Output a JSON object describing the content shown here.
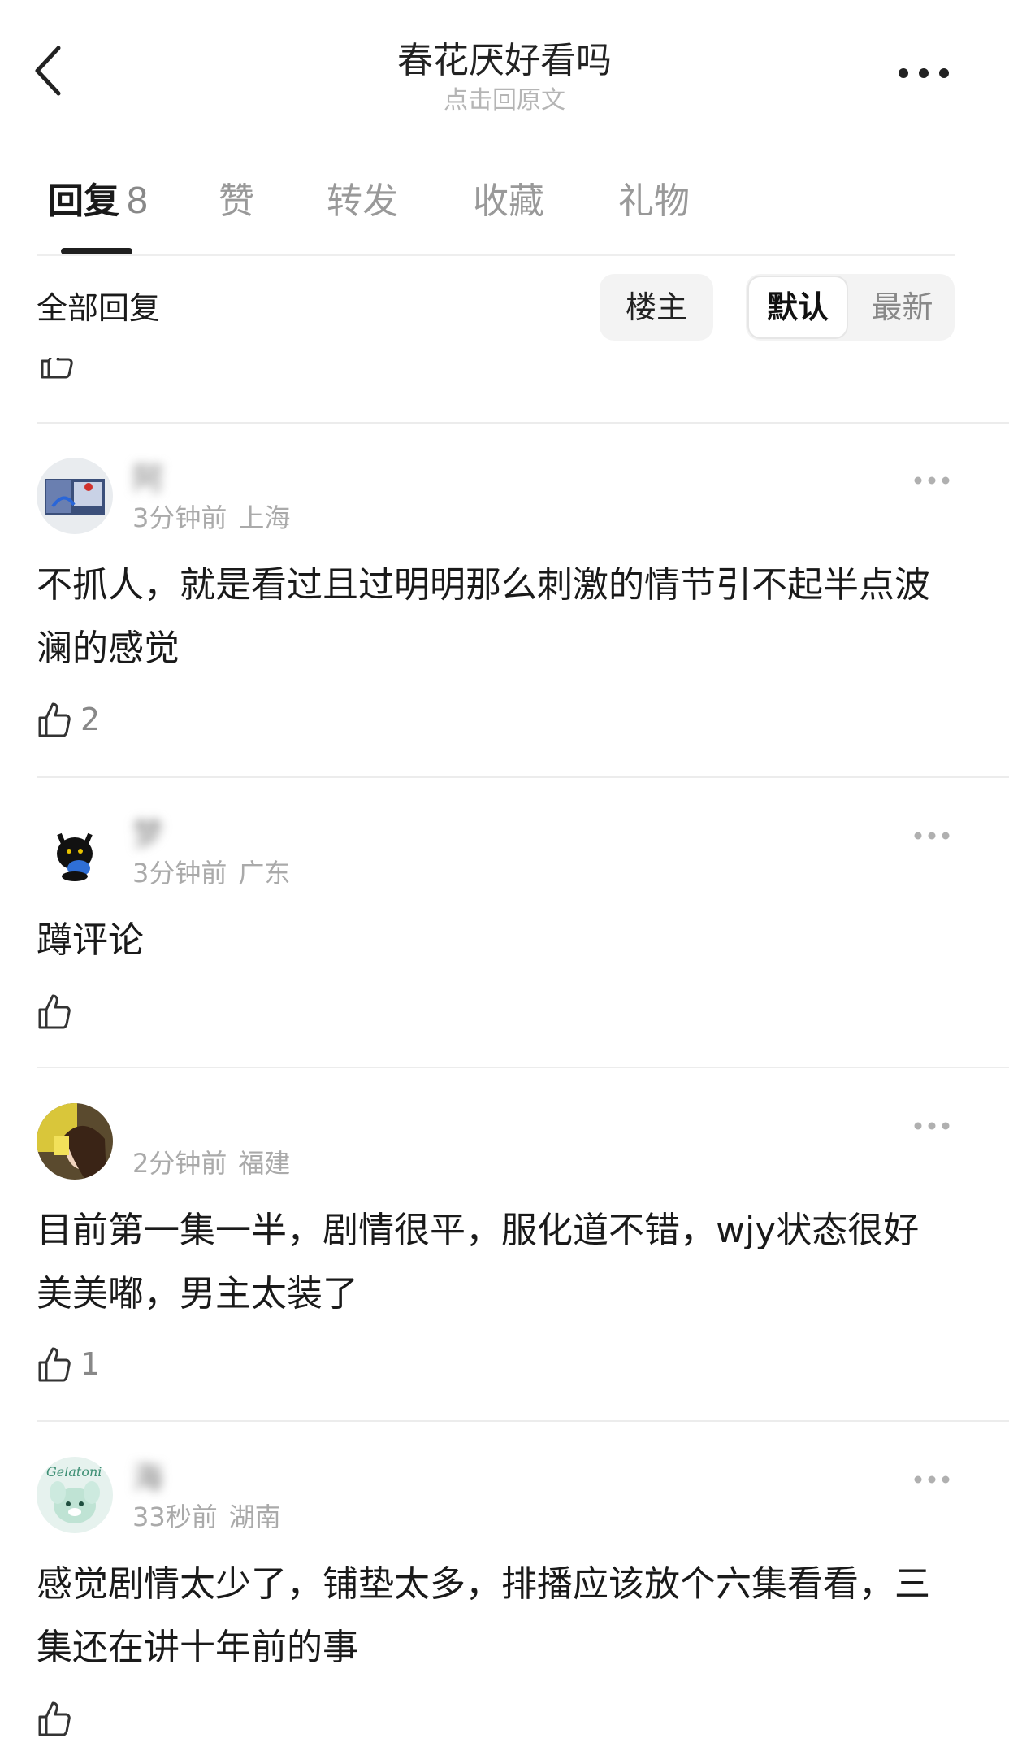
{
  "header": {
    "title": "春花厌好看吗",
    "subtitle": "点击回原文"
  },
  "tabs": [
    {
      "label": "回复",
      "count": "8",
      "active": true
    },
    {
      "label": "赞"
    },
    {
      "label": "转发"
    },
    {
      "label": "收藏"
    },
    {
      "label": "礼物"
    }
  ],
  "filter": {
    "all_replies": "全部回复",
    "poster_only": "楼主",
    "sort_default": "默认",
    "sort_latest": "最新"
  },
  "comments": [
    {
      "name": "阿",
      "time": "3分钟前",
      "location": "上海",
      "text": "不抓人，就是看过且过明明那么刺激的情节引不起半点波澜的感觉",
      "likes": "2"
    },
    {
      "name": "梦",
      "time": "3分钟前",
      "location": "广东",
      "text": "蹲评论",
      "likes": ""
    },
    {
      "name": "",
      "time": "2分钟前",
      "location": "福建",
      "text": "目前第一集一半，剧情很平，服化道不错，wjy状态很好美美嘟，男主太装了",
      "likes": "1"
    },
    {
      "name": "海",
      "time": "33秒前",
      "location": "湖南",
      "text": "感觉剧情太少了，铺垫太多，排播应该放个六集看看，三集还在讲十年前的事",
      "likes": ""
    }
  ],
  "colors": {
    "accent": "#1f1f1f",
    "muted": "#aaaaaa",
    "divider": "#ececec"
  }
}
